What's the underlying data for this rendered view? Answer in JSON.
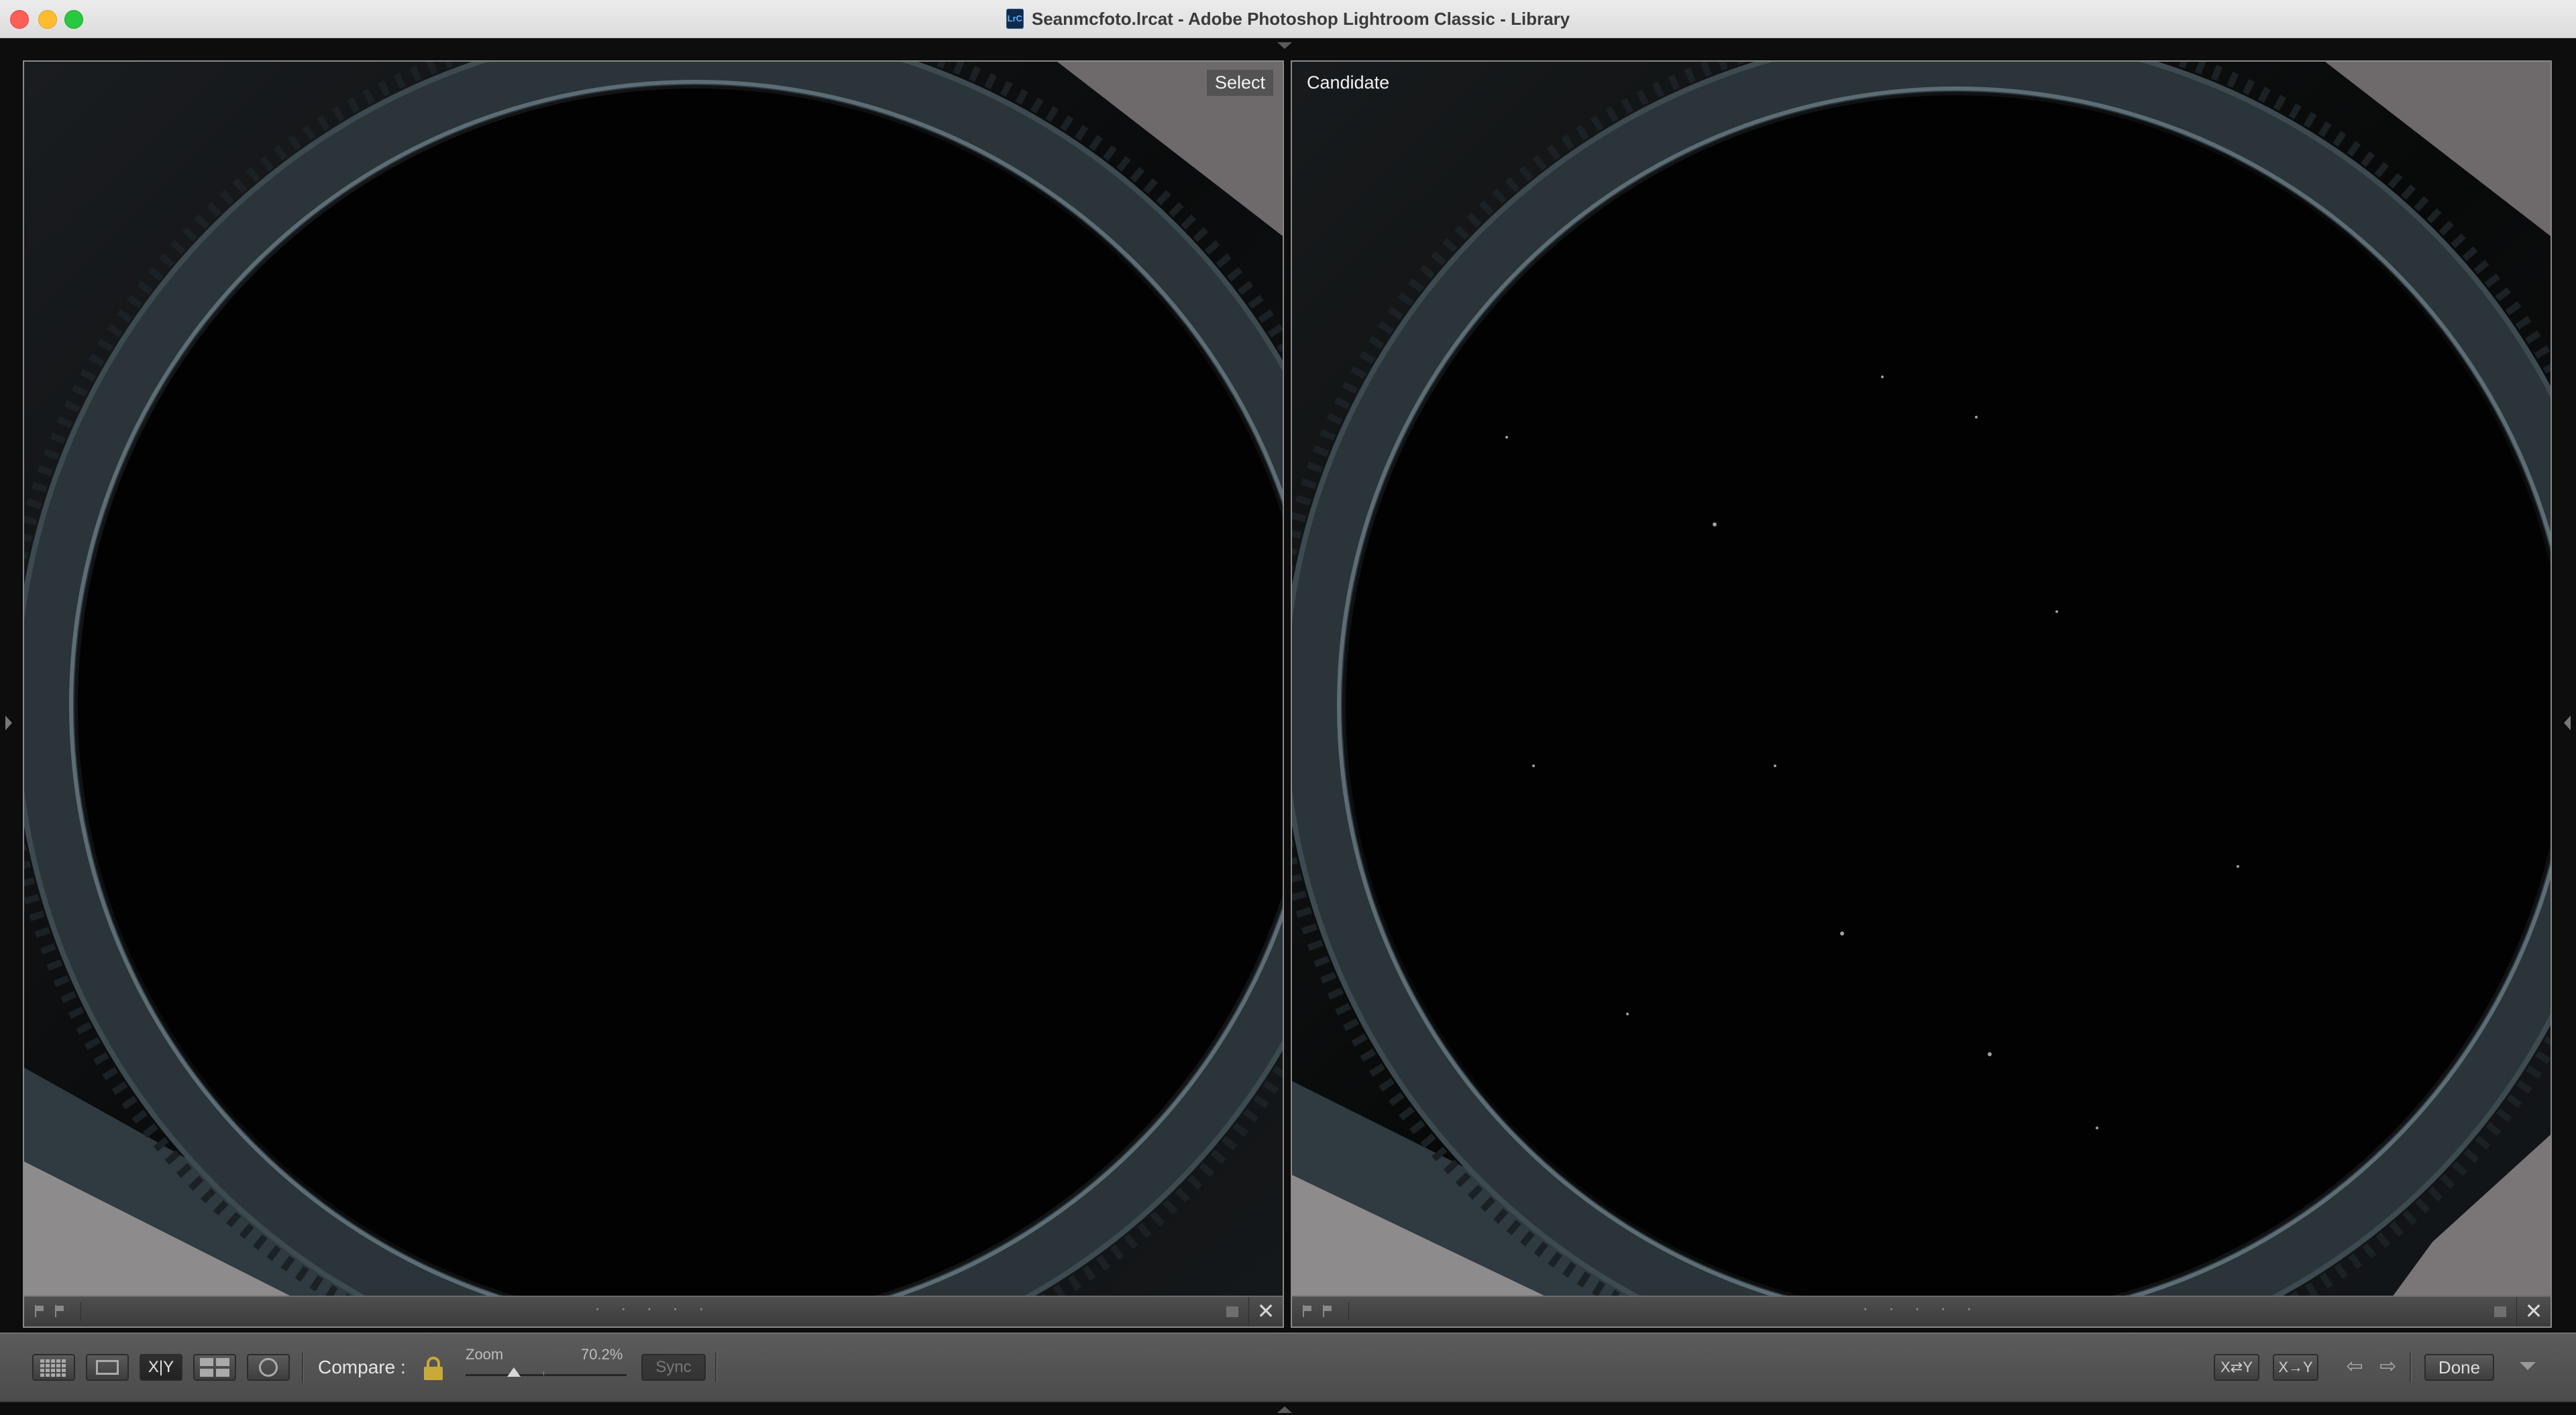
{
  "window": {
    "title": "Seanmcfoto.lrcat - Adobe Photoshop Lightroom Classic - Library",
    "app_icon_text": "LrC"
  },
  "compare": {
    "select_label": "Select",
    "candidate_label": "Candidate",
    "rating_dots": "· · · · ·",
    "close_glyph": "✕"
  },
  "toolbar": {
    "compare_label": "Compare :",
    "zoom_label": "Zoom",
    "zoom_value": "70.2%",
    "zoom_fraction": 0.3,
    "sync_label": "Sync",
    "swap_label": "X⇄Y",
    "make_select_label": "X→Y",
    "done_label": "Done",
    "compare_view_glyph": "X|Y"
  },
  "icons": {
    "grid_view": "grid-icon",
    "loupe_view": "loupe-icon",
    "compare_view": "compare-icon",
    "survey_view": "survey-icon",
    "people_view": "people-icon",
    "lock": "lock-icon",
    "prev": "arrow-left-icon",
    "next": "arrow-right-icon"
  },
  "colors": {
    "lock": "#c8a93a",
    "traffic_close": "#fe5f57",
    "traffic_minimize": "#febc2e",
    "traffic_zoom": "#28c840"
  }
}
